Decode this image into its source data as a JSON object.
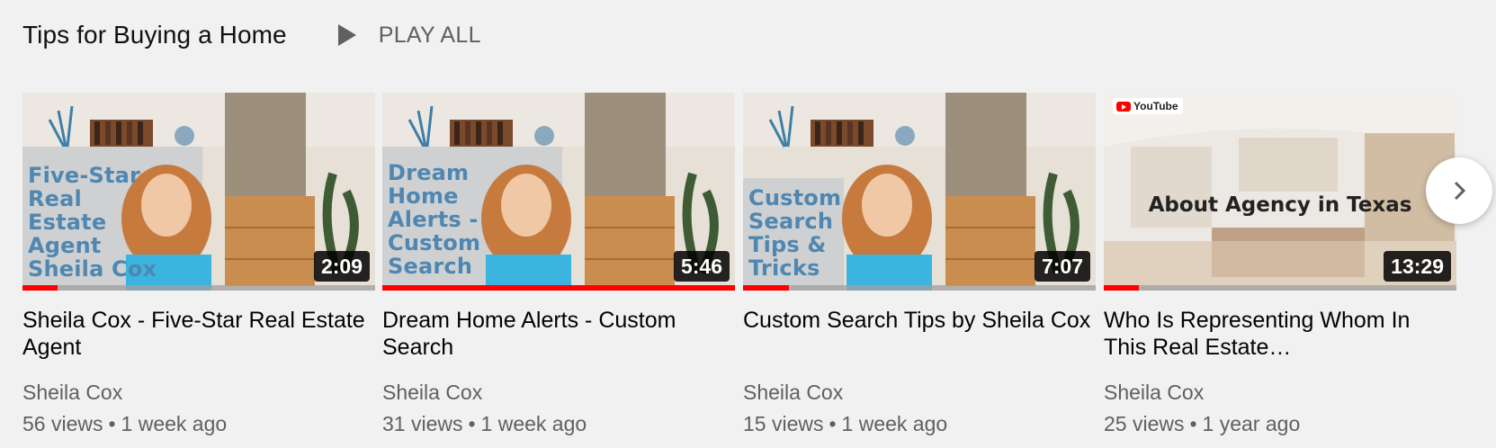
{
  "shelf": {
    "title": "Tips for Buying a Home",
    "play_all_label": "PLAY ALL"
  },
  "videos": [
    {
      "overlay_text": "Five-Star\nReal\nEstate\nAgent\nSheila Cox",
      "duration": "2:09",
      "watched_progress": 0.1,
      "title": "Sheila Cox - Five-Star Real Estate Agent",
      "channel": "Sheila Cox",
      "views": "56 views",
      "age": "1 week ago"
    },
    {
      "overlay_text": "Dream\nHome\nAlerts -\nCustom\nSearch",
      "duration": "5:46",
      "watched_progress": 1.0,
      "title": "Dream Home Alerts - Custom Search",
      "channel": "Sheila Cox",
      "views": "31 views",
      "age": "1 week ago"
    },
    {
      "overlay_text": "Custom\nSearch\nTips &\nTricks",
      "duration": "7:07",
      "watched_progress": 0.13,
      "title": "Custom Search Tips by Sheila Cox",
      "channel": "Sheila Cox",
      "views": "15 views",
      "age": "1 week ago"
    },
    {
      "badge": "YouTube",
      "overlay_text": "About Agency in Texas",
      "duration": "13:29",
      "watched_progress": 0.1,
      "title": "Who Is Representing Whom In This Real Estate…",
      "channel": "Sheila Cox",
      "views": "25 views",
      "age": "1 year ago"
    }
  ],
  "meta_separator": "•",
  "colors": {
    "background": "#f1f1f1",
    "progress": "#ff0000",
    "overlay_text": "#4f87b1",
    "secondary_text": "#606060"
  },
  "icons": {
    "play_all": "play-icon",
    "next": "chevron-right-icon"
  }
}
